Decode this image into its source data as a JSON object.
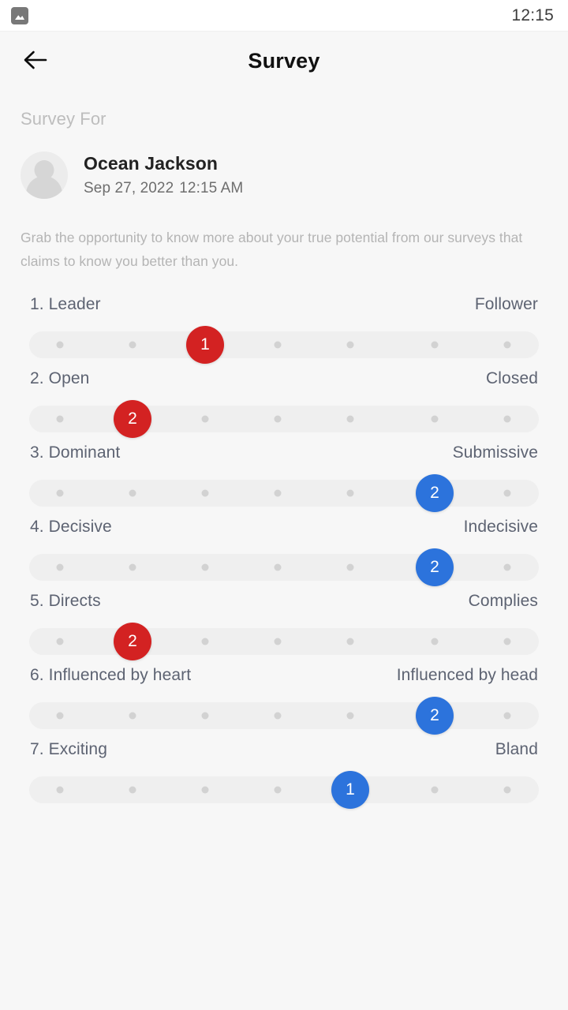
{
  "status_bar": {
    "left_icon": "image-icon",
    "time": "12:15"
  },
  "app_bar": {
    "back_icon": "back-arrow-icon",
    "title": "Survey"
  },
  "survey_for_label": "Survey For",
  "person": {
    "avatar_icon": "user-avatar-placeholder-icon",
    "name": "Ocean Jackson",
    "date": "Sep 27, 2022",
    "time": "12:15 AM"
  },
  "description": "Grab the opportunity to know more about your true potential from our surveys that claims to know you better than you.",
  "colors": {
    "red_knob": "#d32222",
    "blue_knob": "#2c73dc",
    "track": "#efefef",
    "tick": "#d2d2d2",
    "question_text": "#5d6372",
    "page_background": "#f7f7f7"
  },
  "slider_scale": {
    "tick_count": 7,
    "tick_positions": [
      76,
      168,
      260,
      352,
      444,
      551,
      643
    ]
  },
  "questions": [
    {
      "number": "1.",
      "left_label": "1. Leader",
      "right_label": "Follower",
      "value": "1",
      "tick_index": 2,
      "color": "#d32222"
    },
    {
      "number": "2.",
      "left_label": "2. Open",
      "right_label": "Closed",
      "value": "2",
      "tick_index": 1,
      "color": "#d32222"
    },
    {
      "number": "3.",
      "left_label": "3. Dominant",
      "right_label": "Submissive",
      "value": "2",
      "tick_index": 5,
      "color": "#2c73dc"
    },
    {
      "number": "4.",
      "left_label": "4. Decisive",
      "right_label": "Indecisive",
      "value": "2",
      "tick_index": 5,
      "color": "#2c73dc"
    },
    {
      "number": "5.",
      "left_label": "5. Directs",
      "right_label": "Complies",
      "value": "2",
      "tick_index": 1,
      "color": "#d32222"
    },
    {
      "number": "6.",
      "left_label": "6. Influenced by heart",
      "right_label": "Influenced by head",
      "value": "2",
      "tick_index": 5,
      "color": "#2c73dc"
    },
    {
      "number": "7.",
      "left_label": "7. Exciting",
      "right_label": "Bland",
      "value": "1",
      "tick_index": 4,
      "color": "#2c73dc"
    }
  ]
}
